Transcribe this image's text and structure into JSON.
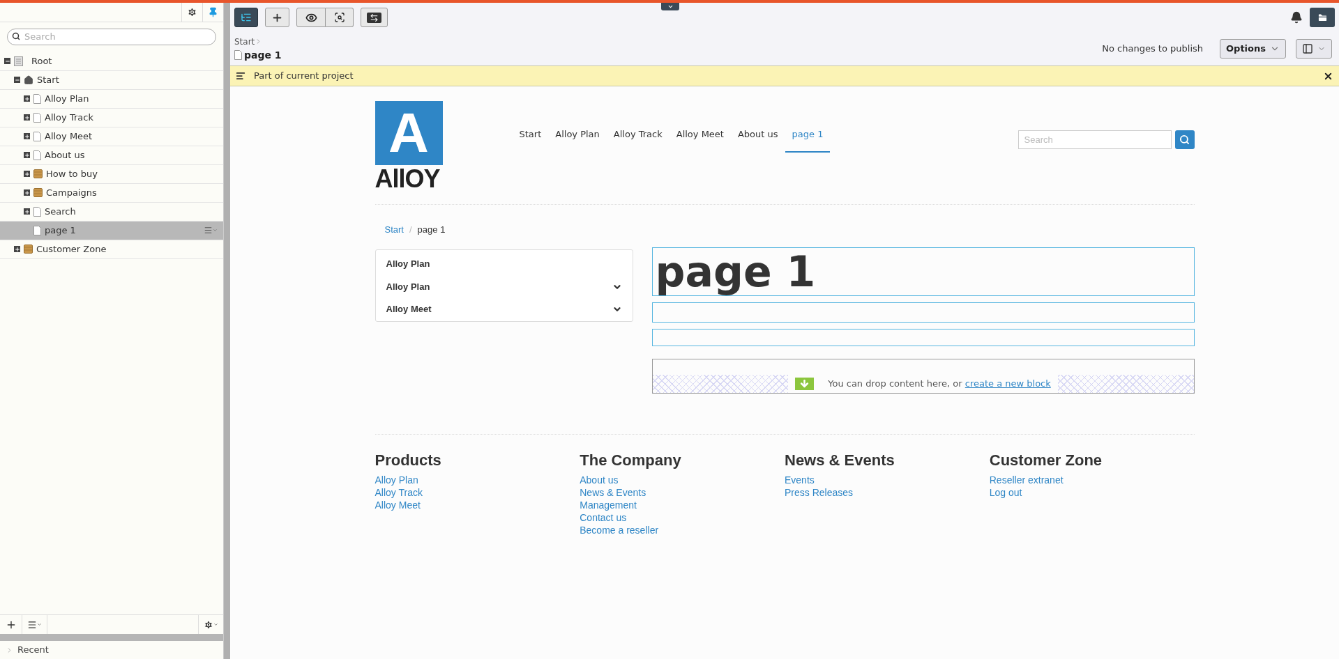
{
  "sidebar": {
    "search": {
      "placeholder": "Search"
    },
    "tree": [
      {
        "label": "Root",
        "kind": "root",
        "expanded": true,
        "selected": false,
        "children": [
          {
            "label": "Start",
            "kind": "home",
            "expanded": true,
            "selected": false,
            "children": [
              {
                "label": "Alloy Plan",
                "kind": "page",
                "expanded": false,
                "selected": false
              },
              {
                "label": "Alloy Track",
                "kind": "page",
                "expanded": false,
                "selected": false
              },
              {
                "label": "Alloy Meet",
                "kind": "page",
                "expanded": false,
                "selected": false
              },
              {
                "label": "About us",
                "kind": "page",
                "expanded": false,
                "selected": false
              },
              {
                "label": "How to buy",
                "kind": "folder",
                "expanded": false,
                "selected": false
              },
              {
                "label": "Campaigns",
                "kind": "folder",
                "expanded": false,
                "selected": false
              },
              {
                "label": "Search",
                "kind": "page",
                "expanded": false,
                "selected": false
              },
              {
                "label": "page 1",
                "kind": "page",
                "selected": true
              }
            ]
          },
          {
            "label": "Customer Zone",
            "kind": "folder",
            "expanded": false,
            "selected": false
          }
        ]
      }
    ],
    "recent": {
      "label": "Recent",
      "expanded": false
    }
  },
  "toolbar": {
    "tree_toggle": {
      "selected": true
    }
  },
  "breadcrumb": {
    "parent": "Start",
    "current": "page 1"
  },
  "publish_status": "No changes to publish",
  "options_button": "Options",
  "notice": "Part of current project",
  "site": {
    "logo": {
      "letter": "A",
      "wordmark": "AllOY"
    },
    "nav": [
      {
        "label": "Start",
        "selected": false
      },
      {
        "label": "Alloy Plan",
        "selected": false
      },
      {
        "label": "Alloy Track",
        "selected": false
      },
      {
        "label": "Alloy Meet",
        "selected": false
      },
      {
        "label": "About us",
        "selected": false
      },
      {
        "label": "page 1",
        "selected": true
      }
    ],
    "search": {
      "placeholder": "Search"
    },
    "breadcrumb": {
      "parent": "Start",
      "separator": "/",
      "current": "page 1"
    },
    "side_menu": [
      {
        "label": "Alloy Plan",
        "expandable": false
      },
      {
        "label": "Alloy Plan",
        "expandable": true
      },
      {
        "label": "Alloy Meet",
        "expandable": true
      }
    ],
    "title": "page 1",
    "drop_zone": {
      "text": "You can drop content here, or",
      "link": "create a new block"
    },
    "footer": [
      {
        "heading": "Products",
        "links": [
          "Alloy Plan",
          "Alloy Track",
          "Alloy Meet"
        ]
      },
      {
        "heading": "The Company",
        "links": [
          "About us",
          "News & Events",
          "Management",
          "Contact us",
          "Become a reseller"
        ]
      },
      {
        "heading": "News & Events",
        "links": [
          "Events",
          "Press Releases"
        ]
      },
      {
        "heading": "Customer Zone",
        "links": [
          "Reseller extranet",
          "Log out"
        ]
      }
    ]
  }
}
